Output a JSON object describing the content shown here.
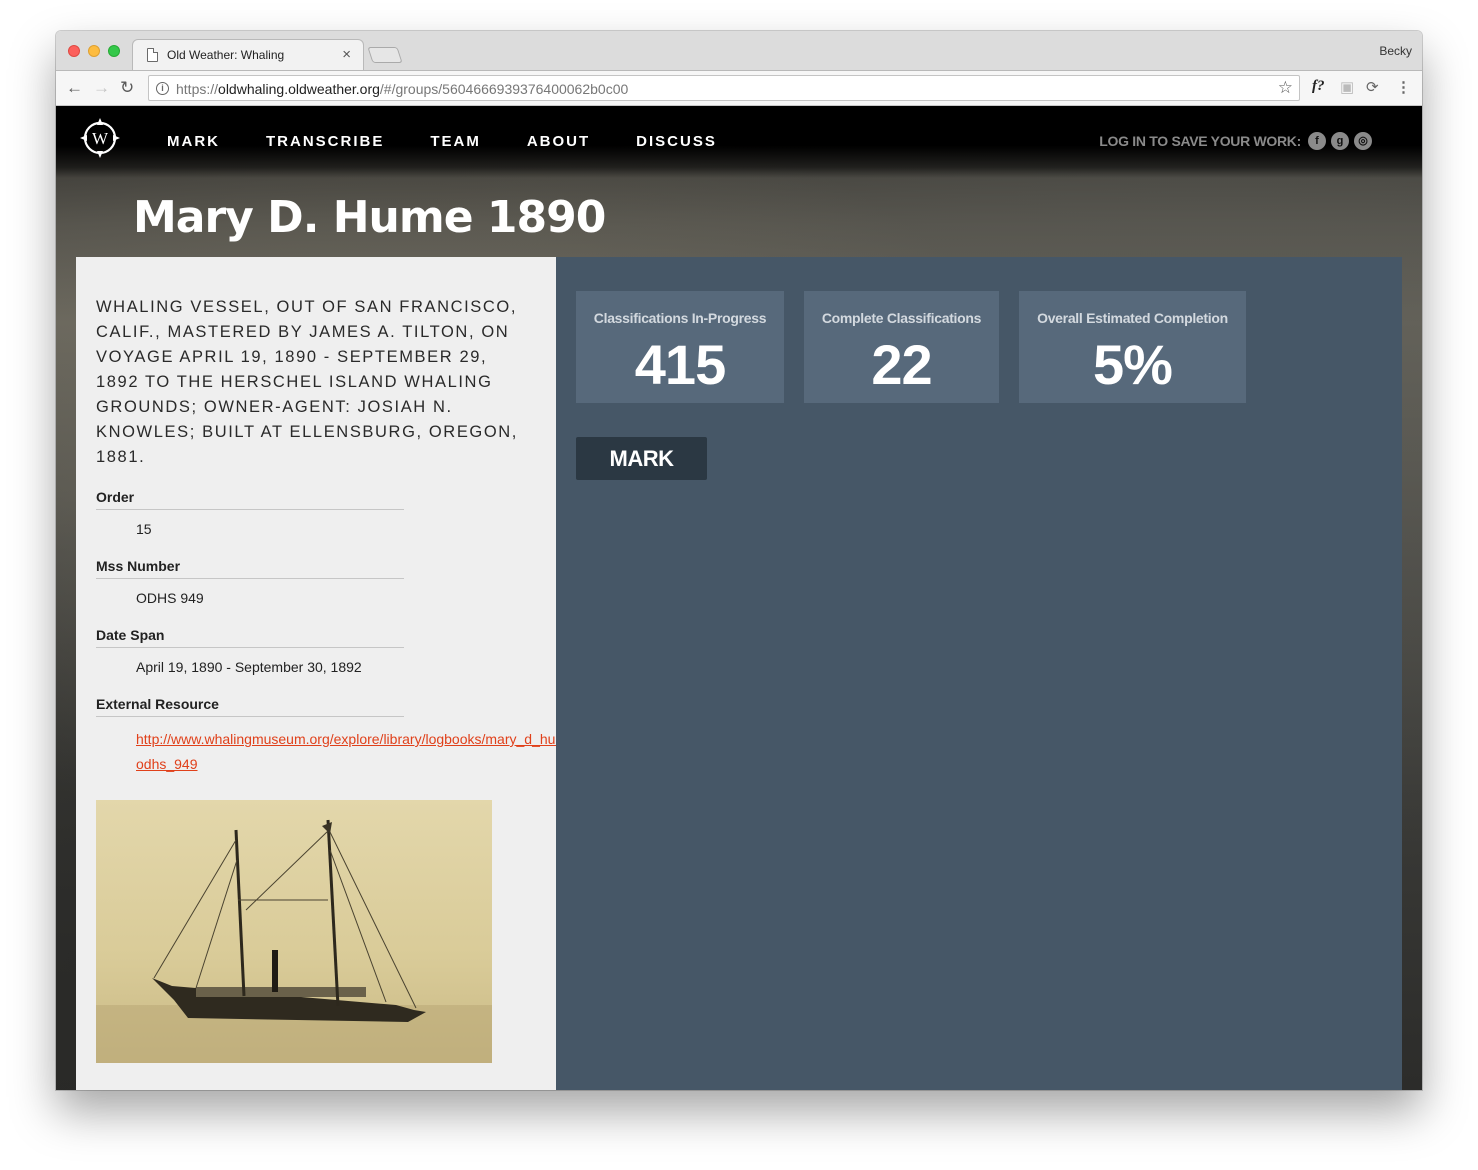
{
  "browser": {
    "tab_title": "Old Weather: Whaling",
    "tab_close": "×",
    "profile_name": "Becky",
    "url_scheme": "https://",
    "url_host": "oldwhaling.oldweather.org",
    "url_path": "/#/groups/5604666939376400062b0c00",
    "ext_label": "f?"
  },
  "header": {
    "nav": [
      "MARK",
      "TRANSCRIBE",
      "TEAM",
      "ABOUT",
      "DISCUSS"
    ],
    "login_text": "LOG IN TO SAVE YOUR WORK:",
    "social_icons": [
      "facebook-icon",
      "google-icon",
      "zooniverse-icon"
    ]
  },
  "page": {
    "title": "Mary D. Hume 1890"
  },
  "details": {
    "description": "WHALING VESSEL, OUT OF SAN FRANCISCO, CALIF., MASTERED BY JAMES A. TILTON, ON VOYAGE APRIL 19, 1890 - SEPTEMBER 29, 1892 TO THE HERSCHEL ISLAND WHALING GROUNDS; OWNER-AGENT: JOSIAH N. KNOWLES; BUILT AT ELLENSBURG, OREGON, 1881.",
    "order_label": "Order",
    "order_value": "15",
    "mss_label": "Mss Number",
    "mss_value": "ODHS 949",
    "date_label": "Date Span",
    "date_value": "April 19, 1890 - September 30, 1892",
    "resource_label": "External Resource",
    "resource_link_line1": "http://www.whalingmuseum.org/explore/library/logbooks/mary_d_hume-",
    "resource_link_line2": "odhs_949"
  },
  "stats": [
    {
      "label": "Classifications In-Progress",
      "value": "415"
    },
    {
      "label": "Complete Classifications",
      "value": "22"
    },
    {
      "label": "Overall Estimated Completion",
      "value": "5%"
    }
  ],
  "actions": {
    "mark_label": "MARK"
  },
  "colors": {
    "right_panel": "#465767",
    "stat_card": "#57697b",
    "mark_button": "#2b3843",
    "link": "#e0401a",
    "left_panel": "#efefef"
  }
}
